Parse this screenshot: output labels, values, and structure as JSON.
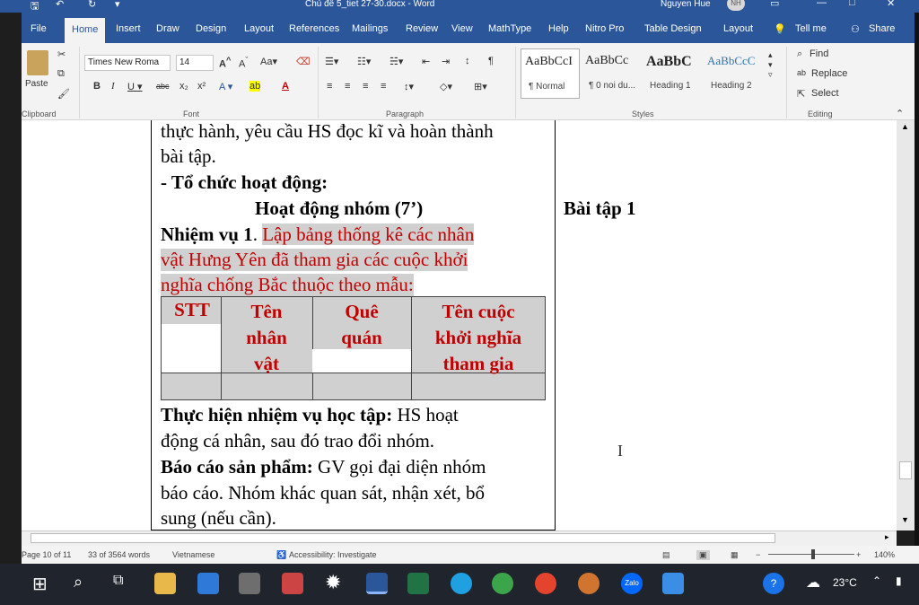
{
  "window": {
    "title": "Chủ đề 5_tiet 27-30.docx - Word",
    "user_name": "Nguyen Hue",
    "user_initials": "NH"
  },
  "tabs": [
    {
      "label": "File"
    },
    {
      "label": "Home"
    },
    {
      "label": "Insert"
    },
    {
      "label": "Draw"
    },
    {
      "label": "Design"
    },
    {
      "label": "Layout"
    },
    {
      "label": "References"
    },
    {
      "label": "Mailings"
    },
    {
      "label": "Review"
    },
    {
      "label": "View"
    },
    {
      "label": "MathType"
    },
    {
      "label": "Help"
    },
    {
      "label": "Nitro Pro"
    },
    {
      "label": "Table Design"
    },
    {
      "label": "Layout"
    },
    {
      "label": "Tell me"
    },
    {
      "label": "Share"
    }
  ],
  "ribbon": {
    "paste_label": "Paste",
    "font_name": "Times New Roma",
    "font_size": "14",
    "styles": [
      {
        "preview": "AaBbCcI",
        "name": "¶ Normal"
      },
      {
        "preview": "AaBbCc",
        "name": "¶ 0 noi du..."
      },
      {
        "preview": "AaBbC",
        "name": "Heading 1"
      },
      {
        "preview": "AaBbCcC",
        "name": "Heading 2"
      }
    ],
    "find_label": "Find",
    "replace_label": "Replace",
    "select_label": "Select",
    "groups": {
      "clipboard": "Clipboard",
      "font": "Font",
      "paragraph": "Paragraph",
      "styles": "Styles",
      "editing": "Editing"
    }
  },
  "document": {
    "line1": "thực hành, yêu cầu HS đọc kĩ và hoàn thành",
    "line2": "bài tập.",
    "line3": "- Tổ chức hoạt động:",
    "line4": "Hoạt động nhóm (7’)",
    "right_heading": "Bài tập 1",
    "task_label": "Nhiệm vụ 1",
    "task_dot": ".",
    "task_text_1": "Lập bảng thống kê các nhân",
    "task_text_2": "vật Hưng Yên đã tham gia các cuộc khởi",
    "task_text_3": "nghĩa chống Bắc thuộc theo mẫu:",
    "table_headers": [
      {
        "lines": [
          "STT"
        ]
      },
      {
        "lines": [
          "Tên",
          "nhân",
          "vật"
        ]
      },
      {
        "lines": [
          "Quê",
          "quán"
        ]
      },
      {
        "lines": [
          "Tên cuộc",
          "khởi nghĩa",
          "tham gia"
        ]
      }
    ],
    "perform_label": "Thực hiện nhiệm vụ học tập:",
    "perform_text_1": " HS hoạt",
    "perform_text_2": "động cá nhân, sau đó trao đổi nhóm.",
    "report_label": "Báo cáo sản phẩm:",
    "report_text_1": " GV gọi đại diện nhóm",
    "report_text_2": "báo cáo. Nhóm khác quan sát, nhận xét, bổ",
    "report_text_3": "sung (nếu cần)."
  },
  "status": {
    "page": "Page 10 of 11",
    "words": "33 of 3564 words",
    "language": "Vietnamese",
    "accessibility": "Accessibility: Investigate",
    "zoom": "140%"
  },
  "taskbar": {
    "temperature": "23°C",
    "zalo": "Zalo"
  },
  "colors": {
    "word_blue": "#2b579a",
    "task_red": "#c00000",
    "highlight_gray": "#d0d0d0"
  }
}
